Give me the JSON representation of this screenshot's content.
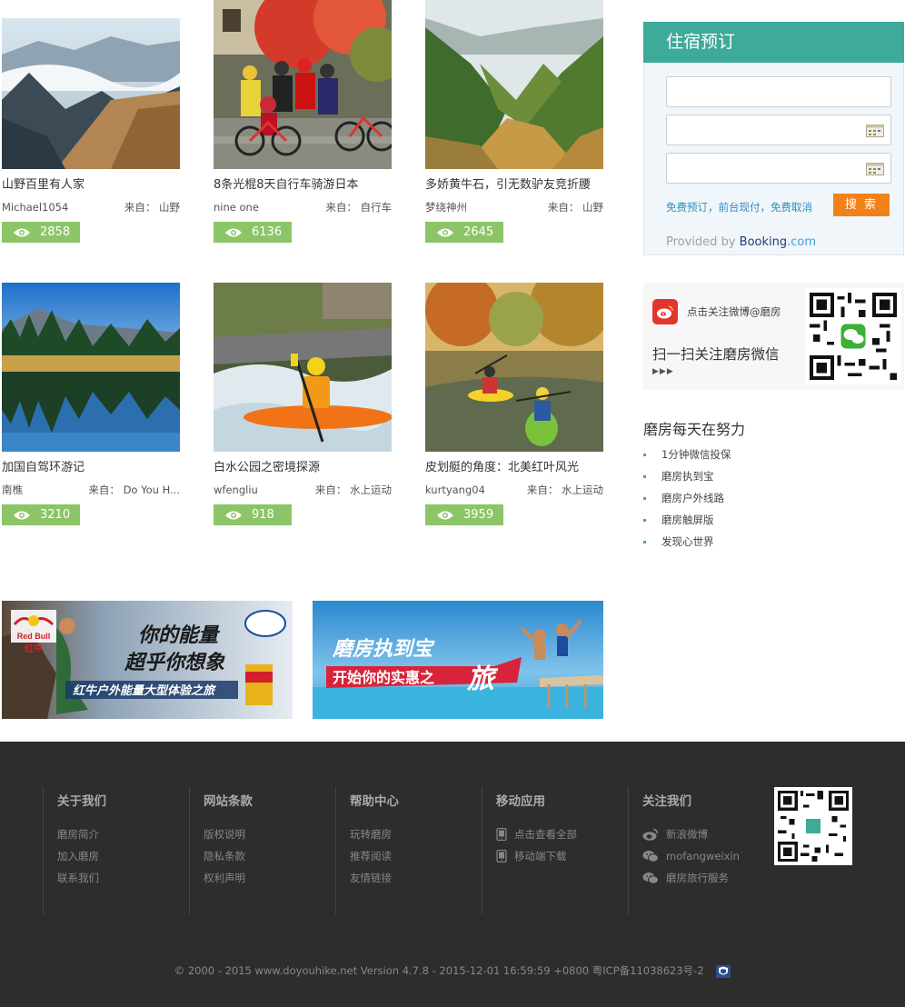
{
  "cards": [
    {
      "title": "山野百里有人家",
      "author": "Michael1054",
      "source_prefix": "来自：",
      "source": "山野",
      "views": "2858"
    },
    {
      "title": "8条光棍8天自行车骑游日本",
      "author": "nine one",
      "source_prefix": "来自：",
      "source": "自行车",
      "views": "6136"
    },
    {
      "title": "多娇黄牛石，引无数驴友竞折腰",
      "author": "梦绕神州",
      "source_prefix": "来自：",
      "source": "山野",
      "views": "2645"
    },
    {
      "title": "加国自驾环游记",
      "author": "南樵",
      "source_prefix": "来自：",
      "source": "Do You H...",
      "views": "3210"
    },
    {
      "title": "白水公园之密境探源",
      "author": "wfengliu",
      "source_prefix": "来自：",
      "source": "水上运动",
      "views": "918"
    },
    {
      "title": "皮划艇的角度：北美红叶风光",
      "author": "kurtyang04",
      "source_prefix": "来自：",
      "source": "水上运动",
      "views": "3959"
    }
  ],
  "banners": {
    "redbull": {
      "brand": "Red Bull",
      "brand_cn": "红牛",
      "headline1": "你的能量",
      "headline2": "超乎你想象",
      "sub": "红牛户外能量大型体验之旅"
    },
    "treasure": {
      "headline": "磨房执到宝",
      "sub": "开始你的实惠之",
      "big": "旅"
    }
  },
  "booking": {
    "title": "住宿预订",
    "links": [
      "免费预订",
      "前台现付",
      "免费取消"
    ],
    "separator": "，",
    "search_label": "搜 索",
    "provided_prefix": "Provided by",
    "provided_brand": "Booking",
    "provided_suffix": ".com"
  },
  "follow": {
    "weibo_text": "点击关注微博@磨房",
    "weixin_text": "扫一扫关注磨房微信",
    "arrows": "▶▶▶"
  },
  "daily": {
    "title": "磨房每天在努力",
    "items": [
      "1分钟微信投保",
      "磨房执到宝",
      "磨房户外线路",
      "磨房触屏版",
      "发现心世界"
    ]
  },
  "footer": {
    "columns": [
      {
        "heading": "关于我们",
        "links": [
          "磨房简介",
          "加入磨房",
          "联系我们"
        ]
      },
      {
        "heading": "网站条款",
        "links": [
          "版权说明",
          "隐私条款",
          "权利声明"
        ]
      },
      {
        "heading": "帮助中心",
        "links": [
          "玩转磨房",
          "推荐阅读",
          "友情链接"
        ]
      },
      {
        "heading": "移动应用",
        "links": [
          "点击查看全部",
          "移动端下载"
        ]
      },
      {
        "heading": "关注我们",
        "links": [
          "新浪微博",
          "mofangweixin",
          "磨房旅行服务"
        ]
      }
    ],
    "copyright": "© 2000 - 2015 www.doyouhike.net Version 4.7.8 - 2015-12-01 16:59:59 +0800 粤ICP备11038623号-2"
  },
  "colors": {
    "accent_green": "#3eaa99",
    "views_green": "#8cc567",
    "search_orange": "#f18219",
    "footer_bg": "#2d2d2d"
  }
}
